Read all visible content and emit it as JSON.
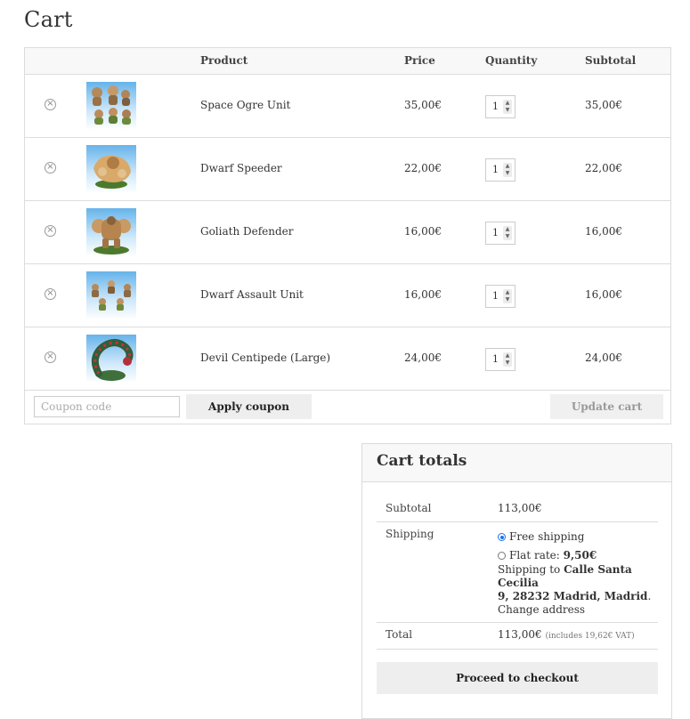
{
  "page": {
    "title": "Cart"
  },
  "table": {
    "headers": {
      "product": "Product",
      "price": "Price",
      "quantity": "Quantity",
      "subtotal": "Subtotal"
    },
    "rows": [
      {
        "name": "Space Ogre Unit",
        "price": "35,00€",
        "qty": "1",
        "subtotal": "35,00€"
      },
      {
        "name": "Dwarf Speeder",
        "price": "22,00€",
        "qty": "1",
        "subtotal": "22,00€"
      },
      {
        "name": "Goliath Defender",
        "price": "16,00€",
        "qty": "1",
        "subtotal": "16,00€"
      },
      {
        "name": "Dwarf Assault Unit",
        "price": "16,00€",
        "qty": "1",
        "subtotal": "16,00€"
      },
      {
        "name": "Devil Centipede (Large)",
        "price": "24,00€",
        "qty": "1",
        "subtotal": "24,00€"
      }
    ]
  },
  "actions": {
    "coupon_placeholder": "Coupon code",
    "apply_label": "Apply coupon",
    "update_label": "Update cart"
  },
  "totals": {
    "title": "Cart totals",
    "subtotal_label": "Subtotal",
    "subtotal_value": "113,00€",
    "shipping_label": "Shipping",
    "free_shipping": "Free shipping",
    "flat_rate_label": "Flat rate:",
    "flat_rate_value": "9,50€",
    "shipping_to_prefix": "Shipping to",
    "address_line1": "Calle Santa Cecilia",
    "address_line2": "9, 28232 Madrid, Madrid",
    "address_suffix": ".",
    "change_address": "Change address",
    "total_label": "Total",
    "total_value": "113,00€",
    "total_tax_note": "(includes 19,62€ VAT)",
    "checkout_label": "Proceed to checkout"
  },
  "colors": {
    "accent_radio": "#1a73e8",
    "header_bg": "#f8f8f8",
    "button_bg": "#eeeeee",
    "border": "#dcdcdc"
  },
  "icons": {
    "remove": "remove-item-icon",
    "spinner": "quantity-spinner-icon"
  }
}
